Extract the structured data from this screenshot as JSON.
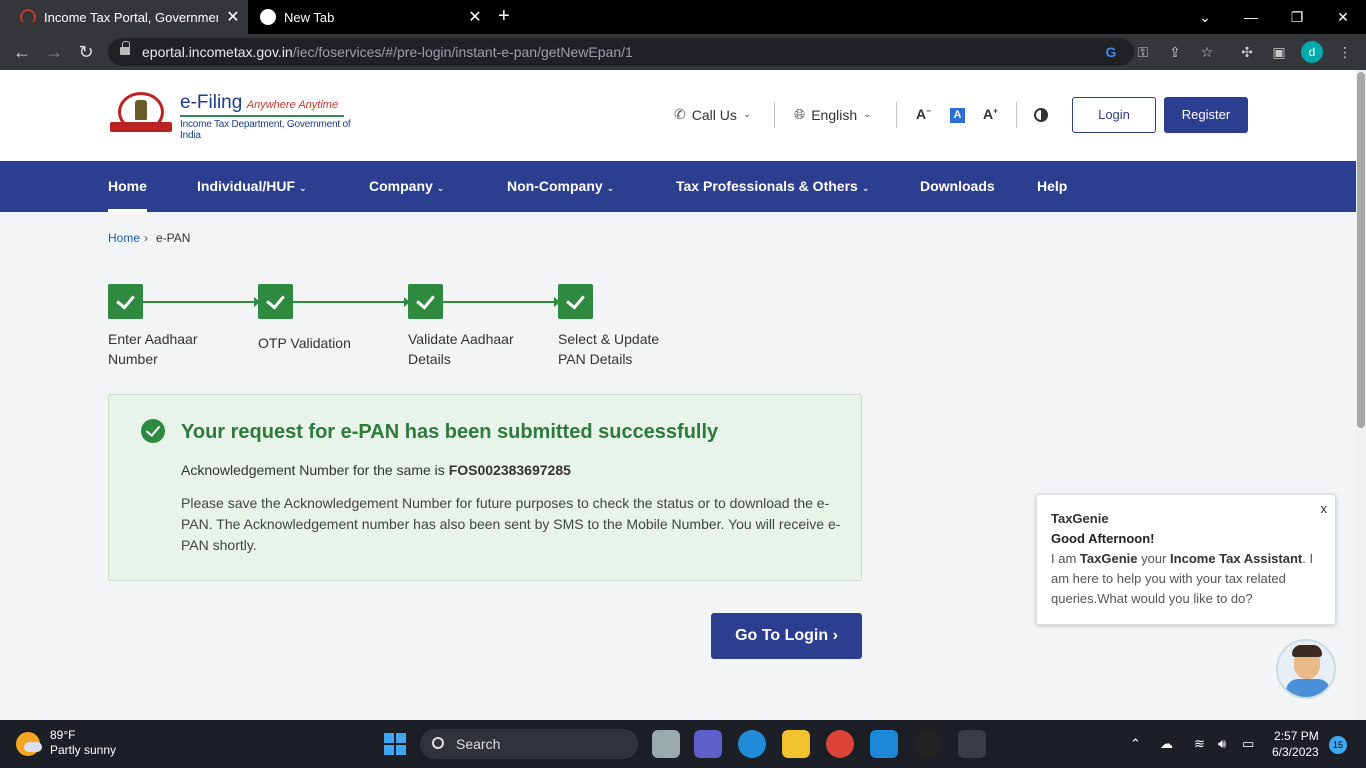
{
  "browser": {
    "tabs": [
      {
        "title": "Income Tax Portal, Government of",
        "active": true
      },
      {
        "title": "New Tab",
        "active": false
      }
    ],
    "url_host": "eportal.incometax.gov.in",
    "url_path": "/iec/foservices/#/pre-login/instant-e-pan/getNewEpan/1",
    "profile_initial": "d"
  },
  "header": {
    "brand": "e-Filing",
    "tagline": "Anywhere Anytime",
    "dept": "Income Tax Department, Government of India",
    "call_us": "Call Us",
    "language": "English",
    "font_decrease": "A",
    "font_normal": "A",
    "font_increase": "A",
    "login": "Login",
    "register": "Register"
  },
  "nav": {
    "items": [
      {
        "label": "Home",
        "dropdown": false
      },
      {
        "label": "Individual/HUF",
        "dropdown": true
      },
      {
        "label": "Company",
        "dropdown": true
      },
      {
        "label": "Non-Company",
        "dropdown": true
      },
      {
        "label": "Tax Professionals & Others",
        "dropdown": true
      },
      {
        "label": "Downloads",
        "dropdown": false
      },
      {
        "label": "Help",
        "dropdown": false
      }
    ]
  },
  "breadcrumb": {
    "home": "Home",
    "current": "e-PAN"
  },
  "steps": [
    {
      "label": "Enter Aadhaar Number",
      "status": "done"
    },
    {
      "label": "OTP Validation",
      "status": "done"
    },
    {
      "label": "Validate Aadhaar Details",
      "status": "done"
    },
    {
      "label": "Select & Update PAN Details",
      "status": "done"
    }
  ],
  "success": {
    "title": "Your request for e-PAN has been submitted successfully",
    "ack_prefix": "Acknowledgement Number for the same is",
    "ack_number": "FOS002383697285",
    "note": "Please save the Acknowledgement Number for future purposes to check the status or to download the e-PAN. The Acknowledgement number has also been sent by SMS to the Mobile Number. You will receive e-PAN shortly."
  },
  "go_to_login": "Go To Login",
  "chat": {
    "close": "x",
    "name": "TaxGenie",
    "greeting": "Good Afternoon!",
    "msg_1": "I am",
    "msg_bot": "TaxGenie",
    "msg_2": "your",
    "msg_role": "Income Tax Assistant",
    "msg_3": ". I am here to help you with your tax related queries.What would you like to do?"
  },
  "taskbar": {
    "temp": "89°F",
    "weather": "Partly sunny",
    "search": "Search",
    "time": "2:57 PM",
    "date": "6/3/2023",
    "notifications": "15"
  },
  "colors": {
    "primary": "#2c3e8f",
    "success": "#2d8a3e",
    "success_bg": "#e8f3ea"
  }
}
